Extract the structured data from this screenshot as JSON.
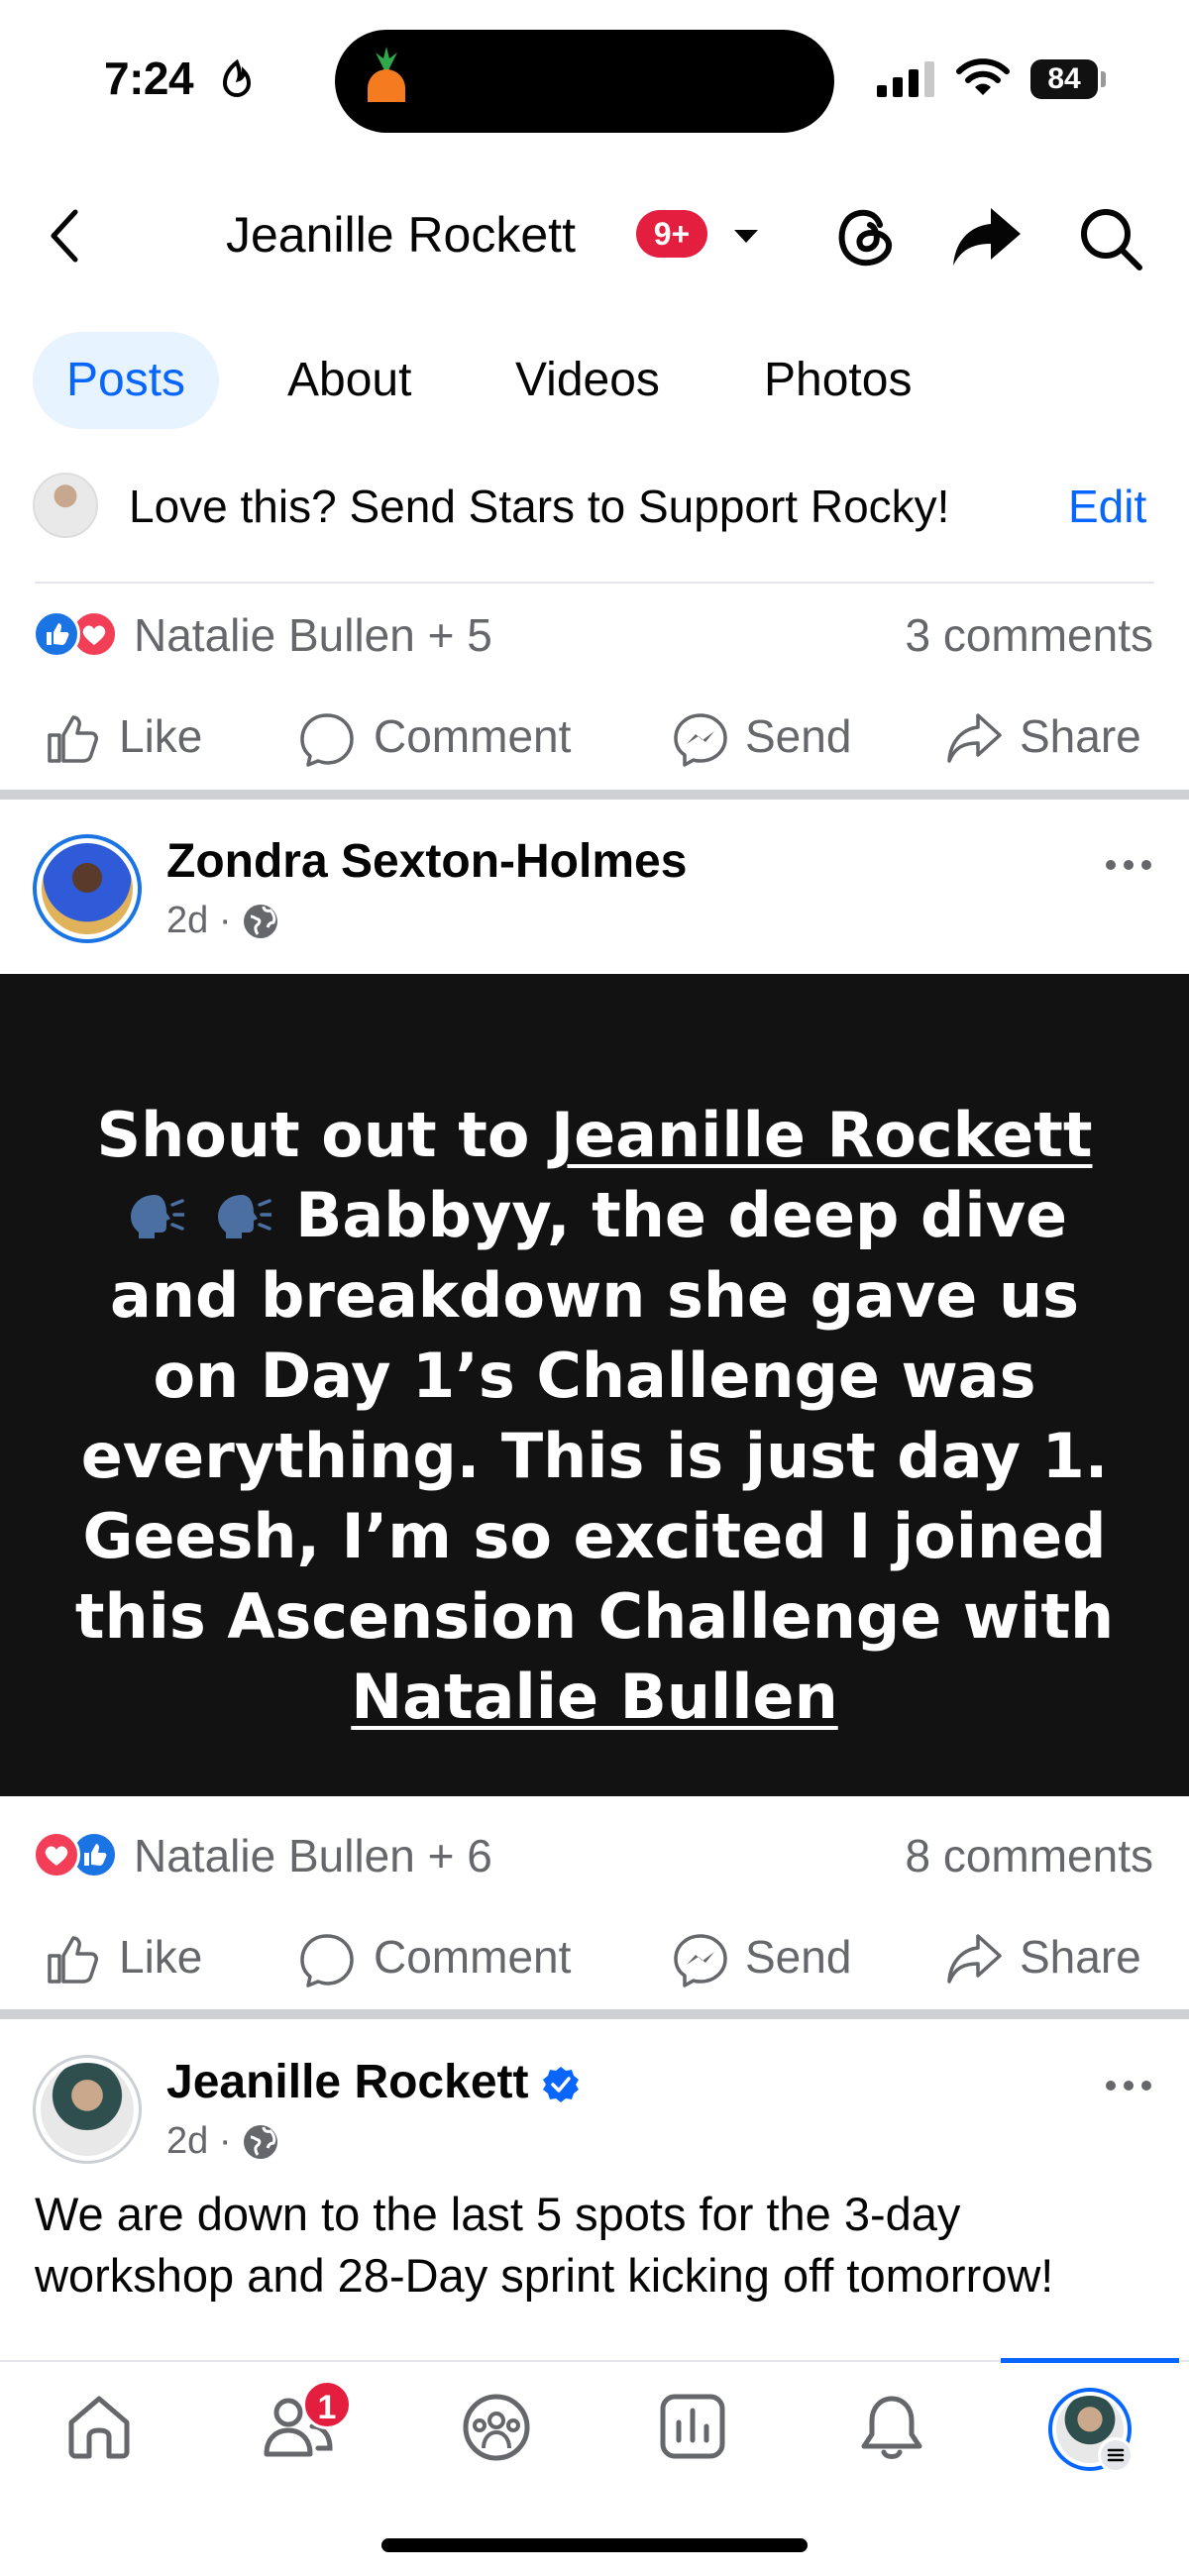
{
  "status_bar": {
    "time": "7:24",
    "battery": "84",
    "icons": [
      "do-not-disturb-icon",
      "carrot-app-icon",
      "cellular-signal-icon",
      "wifi-icon",
      "battery-icon"
    ]
  },
  "header": {
    "title": "Jeanille Rockett",
    "badge": "9+",
    "icons": [
      "back-icon",
      "caret-down-icon",
      "threads-icon",
      "share-icon",
      "search-icon"
    ]
  },
  "tabs": [
    {
      "label": "Posts",
      "active": true
    },
    {
      "label": "About",
      "active": false
    },
    {
      "label": "Videos",
      "active": false
    },
    {
      "label": "Photos",
      "active": false
    }
  ],
  "stars": {
    "text": "Love this? Send Stars to Support Rocky!",
    "edit": "Edit"
  },
  "post1": {
    "reaction_names": "Natalie Bullen + 5",
    "comments": "3 comments"
  },
  "actions": {
    "like": "Like",
    "comment": "Comment",
    "send": "Send",
    "share": "Share"
  },
  "post2": {
    "author": "Zondra Sexton-Holmes",
    "time": "2d",
    "mention1": "Jeanille Rockett",
    "text_lead": "Shout out to ",
    "text_body": " Babbyy, the deep dive and breakdown she gave us on Day 1’s Challenge was everything. This is just day 1. Geesh, I’m so excited I joined this Ascension Challenge with ",
    "mention2": "Natalie Bullen",
    "reaction_names": "Natalie Bullen + 6",
    "comments": "8 comments"
  },
  "post3": {
    "author": "Jeanille Rockett",
    "time": "2d",
    "text": "We are down to the last 5 spots for the 3-day workshop and 28-Day sprint kicking off tomorrow!"
  },
  "bottom_nav": {
    "items": [
      "home-icon",
      "friends-icon",
      "groups-icon",
      "dashboard-icon",
      "notifications-icon",
      "profile-avatar"
    ],
    "badge": "1",
    "active": "profile-avatar"
  },
  "colors": {
    "accent": "#0866ff",
    "badge_red": "#e41e3f",
    "like_blue": "#1b74e4",
    "love_red": "#f33e58",
    "secondary_text": "#65676b",
    "post_background": "#121212"
  }
}
